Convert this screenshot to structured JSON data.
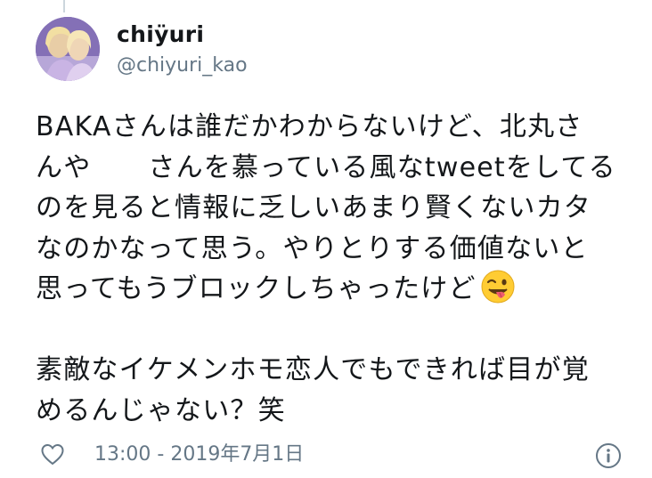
{
  "user": {
    "display_name": "chiÿuri",
    "handle": "@chiyuri_kao",
    "avatar_icon": "profile-photo"
  },
  "tweet": {
    "lines": [
      "BAKAさんは誰だかわからないけど、北丸さ",
      "んや",
      "さんを慕っている風なtweetをしてる",
      "のを見ると情報に乏しいあまり賢くないカタ",
      "なのかなって思う。やりとりする価値ないと",
      "思ってもうブロックしちゃったけど",
      "素敵なイケメンホモ恋人でもできれば目が覚",
      "めるんじゃない？笑"
    ],
    "emoji": "winking-face-with-tongue"
  },
  "footer": {
    "timestamp": "13:00 - 2019年7月1日",
    "like_icon": "heart-icon",
    "info_icon": "info-icon"
  },
  "colors": {
    "text": "#14171a",
    "secondary": "#657786",
    "emoji_face": "#ffcc33"
  }
}
